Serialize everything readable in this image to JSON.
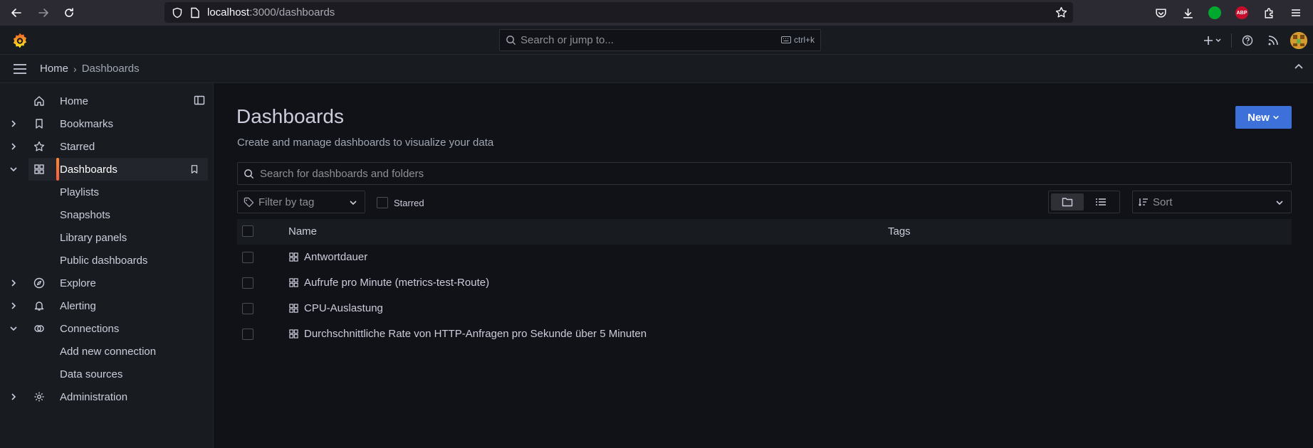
{
  "browser": {
    "url_host": "localhost",
    "url_path": ":3000/dashboards",
    "extensions": {
      "abp_label": "ABP"
    }
  },
  "topbar": {
    "search_placeholder": "Search or jump to...",
    "shortcut": "ctrl+k"
  },
  "breadcrumb": {
    "home": "Home",
    "separator": "›",
    "current": "Dashboards"
  },
  "sidebar": {
    "items": [
      {
        "label": "Home",
        "icon": "home-icon",
        "expandable": false
      },
      {
        "label": "Bookmarks",
        "icon": "bookmark-icon",
        "expandable": true
      },
      {
        "label": "Starred",
        "icon": "star-icon",
        "expandable": true
      },
      {
        "label": "Dashboards",
        "icon": "apps-icon",
        "expandable": true,
        "expanded": true,
        "active": true
      },
      {
        "label": "Playlists",
        "sub": true
      },
      {
        "label": "Snapshots",
        "sub": true
      },
      {
        "label": "Library panels",
        "sub": true
      },
      {
        "label": "Public dashboards",
        "sub": true
      },
      {
        "label": "Explore",
        "icon": "compass-icon",
        "expandable": true
      },
      {
        "label": "Alerting",
        "icon": "bell-icon",
        "expandable": true
      },
      {
        "label": "Connections",
        "icon": "link-icon",
        "expandable": true,
        "expanded": true
      },
      {
        "label": "Add new connection",
        "sub": true
      },
      {
        "label": "Data sources",
        "sub": true
      },
      {
        "label": "Administration",
        "icon": "gear-icon",
        "expandable": true
      }
    ]
  },
  "main": {
    "title": "Dashboards",
    "subtitle": "Create and manage dashboards to visualize your data",
    "new_button": "New",
    "search_placeholder": "Search for dashboards and folders",
    "tag_filter_placeholder": "Filter by tag",
    "starred_label": "Starred",
    "sort_placeholder": "Sort",
    "table": {
      "columns": [
        "Name",
        "Tags"
      ],
      "rows": [
        {
          "name": "Antwortdauer"
        },
        {
          "name": "Aufrufe pro Minute (metrics-test-Route)"
        },
        {
          "name": "CPU-Auslastung"
        },
        {
          "name": "Durchschnittliche Rate von HTTP-Anfragen pro Sekunde über 5 Minuten"
        }
      ]
    }
  },
  "colors": {
    "accent": "#3d71d9",
    "active_indicator": "#f55f3e",
    "background": "#111217",
    "panel": "#181b1f"
  }
}
